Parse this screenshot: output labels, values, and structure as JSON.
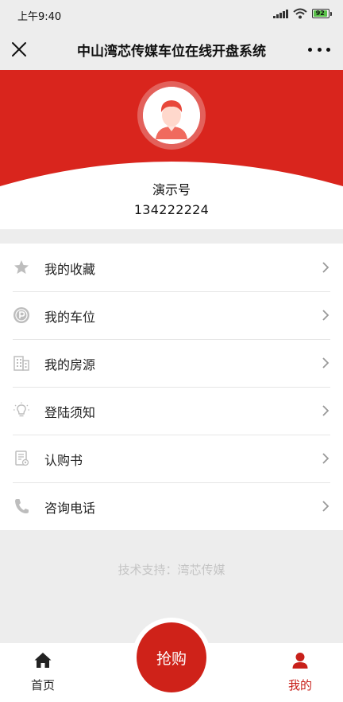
{
  "status_bar": {
    "time": "上午9:40",
    "battery": "92",
    "battery_level": 0.92,
    "icons": [
      "signal-icon",
      "wifi-icon",
      "battery-icon"
    ]
  },
  "nav": {
    "title": "中山湾芯传媒车位在线开盘系统",
    "close_icon": "close-icon",
    "more_icon": "more-icon"
  },
  "profile": {
    "name": "演示号",
    "phone": "134222224",
    "accent_color": "#d9251d"
  },
  "menu": {
    "items": [
      {
        "label": "我的收藏",
        "icon": "star-icon"
      },
      {
        "label": "我的车位",
        "icon": "parking-icon"
      },
      {
        "label": "我的房源",
        "icon": "building-icon"
      },
      {
        "label": "登陆须知",
        "icon": "bulb-icon"
      },
      {
        "label": "认购书",
        "icon": "document-icon"
      },
      {
        "label": "咨询电话",
        "icon": "phone-icon"
      }
    ]
  },
  "footer": {
    "support_text": "技术支持：湾芯传媒"
  },
  "tabbar": {
    "home_label": "首页",
    "grab_label": "抢购",
    "mine_label": "我的",
    "active_color": "#c8201a"
  }
}
